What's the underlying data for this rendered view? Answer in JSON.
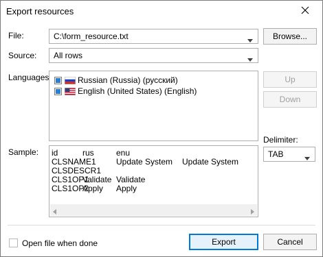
{
  "window": {
    "title": "Export resources",
    "close_glyph": "✕"
  },
  "file": {
    "label": "File:",
    "value": "C:\\form_resource.txt",
    "browse_label": "Browse..."
  },
  "source": {
    "label": "Source:",
    "value": "All rows"
  },
  "languages": {
    "label": "Languages:",
    "items": [
      {
        "label": "Russian (Russia) (русский)",
        "checked": true,
        "flag": "russia-flag-icon"
      },
      {
        "label": "English (United States) (English)",
        "checked": true,
        "flag": "us-flag-icon"
      }
    ],
    "up_label": "Up",
    "down_label": "Down"
  },
  "delimiter": {
    "label": "Delimiter:",
    "value": "TAB"
  },
  "sample": {
    "label": "Sample:",
    "rows": [
      [
        "id",
        "rus",
        "enu",
        ""
      ],
      [
        "CLSNAME1",
        "",
        "Update System",
        "Update System"
      ],
      [
        "CLSDESCR1",
        "",
        "",
        ""
      ],
      [
        "CLS1OP1",
        "Validate",
        "Validate",
        ""
      ],
      [
        "CLS1OP2",
        "Apply",
        "Apply",
        ""
      ]
    ]
  },
  "footer": {
    "open_when_done_label": "Open file when done",
    "open_when_done_checked": false,
    "export_label": "Export",
    "cancel_label": "Cancel"
  },
  "colors": {
    "accent": "#0078d7",
    "check_fill": "#2d7dd2"
  }
}
